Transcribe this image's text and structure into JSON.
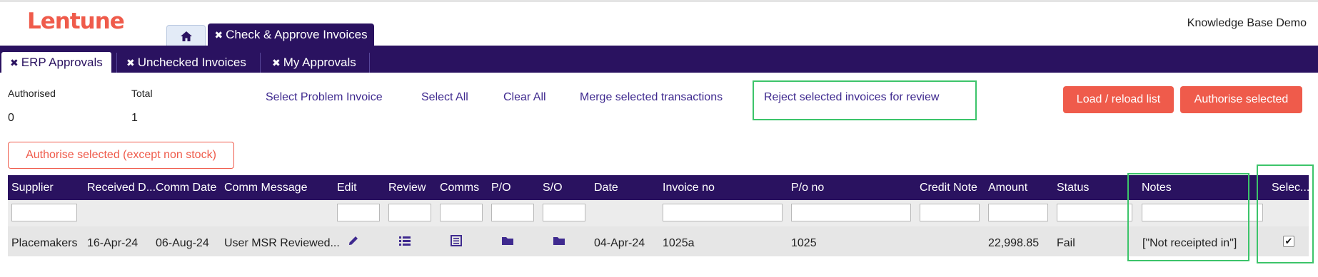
{
  "app": {
    "logo": "Lentune",
    "account": "Knowledge Base Demo"
  },
  "tabs": {
    "home_icon": "home-icon",
    "active": "Check & Approve Invoices"
  },
  "subtabs": [
    {
      "label": "ERP Approvals",
      "active": true
    },
    {
      "label": "Unchecked Invoices",
      "active": false
    },
    {
      "label": "My Approvals",
      "active": false
    }
  ],
  "stats": {
    "authorised_label": "Authorised",
    "authorised_value": "0",
    "total_label": "Total",
    "total_value": "1"
  },
  "actions": {
    "select_problem": "Select Problem Invoice",
    "select_all": "Select All",
    "clear_all": "Clear All",
    "merge": "Merge selected transactions",
    "reject": "Reject selected invoices for review",
    "load": "Load / reload list",
    "authorise": "Authorise selected",
    "authorise_except": "Authorise selected (except non stock)"
  },
  "table": {
    "columns": [
      "Supplier",
      "Received D...",
      "Comm Date",
      "Comm Message",
      "Edit",
      "Review",
      "Comms",
      "P/O",
      "S/O",
      "Date",
      "Invoice no",
      "P/o no",
      "Credit Note",
      "Amount",
      "Status",
      "Notes",
      "Selec..."
    ],
    "rows": [
      {
        "supplier": "Placemakers",
        "received": "16-Apr-24",
        "comm_date": "06-Aug-24",
        "comm_message": "User MSR Reviewed...",
        "date": "04-Apr-24",
        "invoice_no": "1025a",
        "po_no": "1025",
        "credit_note": "",
        "amount": "22,998.85",
        "status": "Fail",
        "notes": "[\"Not receipted in\"]",
        "selected": "✔"
      }
    ]
  },
  "colors": {
    "brand": "#ef5b4b",
    "nav": "#2a1260",
    "highlight": "#3cc46a"
  }
}
